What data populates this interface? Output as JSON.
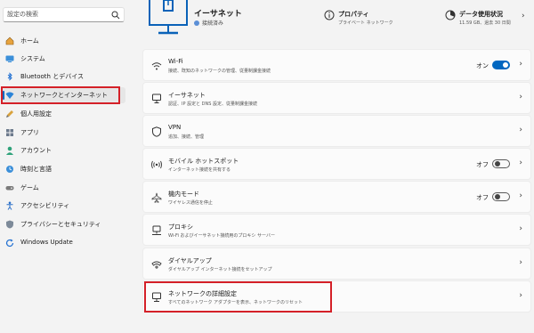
{
  "search": {
    "placeholder": "設定の検索"
  },
  "sidebar": {
    "items": [
      {
        "label": "ホーム",
        "icon": "home-icon"
      },
      {
        "label": "システム",
        "icon": "system-icon"
      },
      {
        "label": "Bluetooth とデバイス",
        "icon": "bluetooth-icon"
      },
      {
        "label": "ネットワークとインターネット",
        "icon": "network-icon",
        "active": true
      },
      {
        "label": "個人用設定",
        "icon": "brush-icon"
      },
      {
        "label": "アプリ",
        "icon": "apps-icon"
      },
      {
        "label": "アカウント",
        "icon": "account-icon"
      },
      {
        "label": "時刻と言語",
        "icon": "time-language-icon"
      },
      {
        "label": "ゲーム",
        "icon": "gaming-icon"
      },
      {
        "label": "アクセシビリティ",
        "icon": "accessibility-icon"
      },
      {
        "label": "プライバシーとセキュリティ",
        "icon": "shield-icon"
      },
      {
        "label": "Windows Update",
        "icon": "update-icon"
      }
    ]
  },
  "header": {
    "title": "イーサネット",
    "status": "接続済み",
    "property": {
      "title": "プロパティ",
      "sub": "プライベート ネットワーク"
    },
    "data_usage": {
      "title": "データ使用状況",
      "sub": "11.59 GB、過去 30 日間"
    }
  },
  "cards": [
    {
      "title": "Wi-Fi",
      "sub": "接続、既知のネットワークの管理、従量制課金接続",
      "icon": "wifi-icon",
      "toggle": "on",
      "state": "オン",
      "chevron": "›"
    },
    {
      "title": "イーサネット",
      "sub": "認証、IP 設定と DNS 設定、従量制課金接続",
      "icon": "ethernet-icon",
      "chevron": "›"
    },
    {
      "title": "VPN",
      "sub": "追加、接続、管理",
      "icon": "vpn-shield-icon",
      "chevron": "›"
    },
    {
      "title": "モバイル ホットスポット",
      "sub": "インターネット接続を共有する",
      "icon": "hotspot-icon",
      "toggle": "off",
      "state": "オフ",
      "chevron": "›"
    },
    {
      "title": "機内モード",
      "sub": "ワイヤレス通信を停止",
      "icon": "airplane-icon",
      "toggle": "off",
      "state": "オフ",
      "chevron": "›"
    },
    {
      "title": "プロキシ",
      "sub": "Wi-Fi およびイーサネット接続用のプロキシ サーバー",
      "icon": "proxy-icon",
      "chevron": "›"
    },
    {
      "title": "ダイヤルアップ",
      "sub": "ダイヤルアップ インターネット接続をセットアップ",
      "icon": "dialup-icon",
      "chevron": "›"
    },
    {
      "title": "ネットワークの詳細設定",
      "sub": "すべてのネットワーク アダプターを表示、ネットワークのリセット",
      "icon": "advanced-network-icon",
      "chevron": "›"
    }
  ],
  "colors": {
    "accent": "#0067c0",
    "highlight_box": "#d42028",
    "background": "#f3f3f3"
  }
}
